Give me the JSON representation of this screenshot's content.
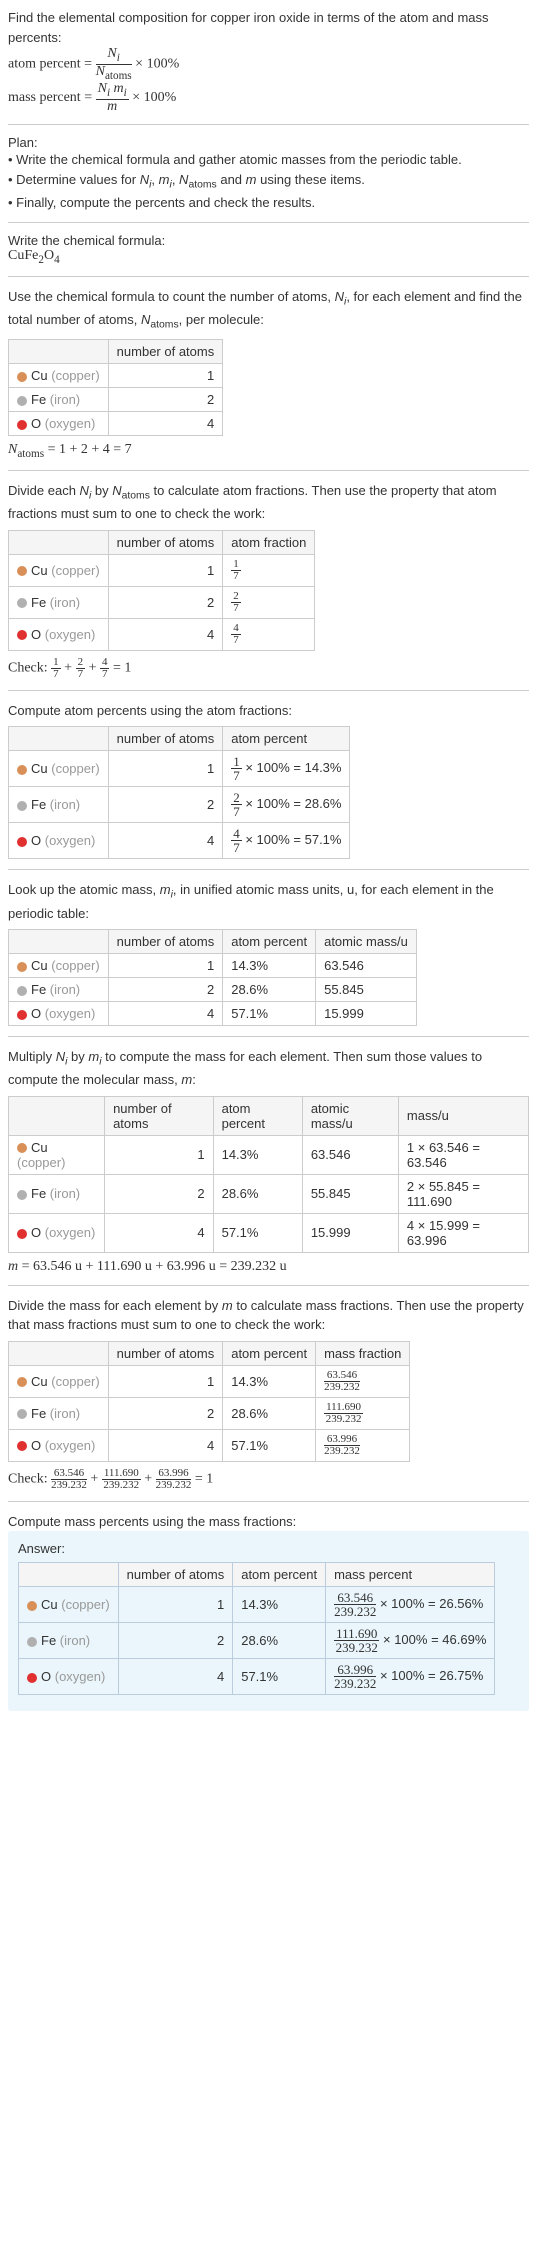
{
  "intro": {
    "text1": "Find the elemental composition for copper iron oxide in terms of the atom and mass percents:",
    "atom_formula": "atom percent = N_i / N_atoms × 100%",
    "mass_formula": "mass percent = N_i m_i / m × 100%"
  },
  "plan": {
    "title": "Plan:",
    "b1": "• Write the chemical formula and gather atomic masses from the periodic table.",
    "b2": "• Determine values for N_i, m_i, N_atoms and m using these items.",
    "b3": "• Finally, compute the percents and check the results."
  },
  "formula": {
    "title": "Write the chemical formula:",
    "value": "CuFe₂O₄"
  },
  "count": {
    "text": "Use the chemical formula to count the number of atoms, N_i, for each element and find the total number of atoms, N_atoms, per molecule:",
    "h_atoms": "number of atoms",
    "rows": [
      {
        "sym": "Cu",
        "name": "(copper)",
        "color": "#d99058",
        "n": "1"
      },
      {
        "sym": "Fe",
        "name": "(iron)",
        "color": "#b0b0b0",
        "n": "2"
      },
      {
        "sym": "O",
        "name": "(oxygen)",
        "color": "#e03030",
        "n": "4"
      }
    ],
    "total": "N_atoms = 1 + 2 + 4 = 7"
  },
  "atomfrac": {
    "text": "Divide each N_i by N_atoms to calculate atom fractions. Then use the property that atom fractions must sum to one to check the work:",
    "h_atoms": "number of atoms",
    "h_frac": "atom fraction",
    "rows": [
      {
        "sym": "Cu",
        "name": "(copper)",
        "color": "#d99058",
        "n": "1",
        "fn": "1",
        "fd": "7"
      },
      {
        "sym": "Fe",
        "name": "(iron)",
        "color": "#b0b0b0",
        "n": "2",
        "fn": "2",
        "fd": "7"
      },
      {
        "sym": "O",
        "name": "(oxygen)",
        "color": "#e03030",
        "n": "4",
        "fn": "4",
        "fd": "7"
      }
    ],
    "check": "Check: 1/7 + 2/7 + 4/7 = 1"
  },
  "atompct": {
    "text": "Compute atom percents using the atom fractions:",
    "h_atoms": "number of atoms",
    "h_pct": "atom percent",
    "rows": [
      {
        "sym": "Cu",
        "name": "(copper)",
        "color": "#d99058",
        "n": "1",
        "fn": "1",
        "fd": "7",
        "pct": "14.3%"
      },
      {
        "sym": "Fe",
        "name": "(iron)",
        "color": "#b0b0b0",
        "n": "2",
        "fn": "2",
        "fd": "7",
        "pct": "28.6%"
      },
      {
        "sym": "O",
        "name": "(oxygen)",
        "color": "#e03030",
        "n": "4",
        "fn": "4",
        "fd": "7",
        "pct": "57.1%"
      }
    ]
  },
  "atommass": {
    "text": "Look up the atomic mass, m_i, in unified atomic mass units, u, for each element in the periodic table:",
    "h_atoms": "number of atoms",
    "h_pct": "atom percent",
    "h_mass": "atomic mass/u",
    "rows": [
      {
        "sym": "Cu",
        "name": "(copper)",
        "color": "#d99058",
        "n": "1",
        "pct": "14.3%",
        "m": "63.546"
      },
      {
        "sym": "Fe",
        "name": "(iron)",
        "color": "#b0b0b0",
        "n": "2",
        "pct": "28.6%",
        "m": "55.845"
      },
      {
        "sym": "O",
        "name": "(oxygen)",
        "color": "#e03030",
        "n": "4",
        "pct": "57.1%",
        "m": "15.999"
      }
    ]
  },
  "molmass": {
    "text": "Multiply N_i by m_i to compute the mass for each element. Then sum those values to compute the molecular mass, m:",
    "h_atoms": "number of atoms",
    "h_pct": "atom percent",
    "h_amass": "atomic mass/u",
    "h_massu": "mass/u",
    "rows": [
      {
        "sym": "Cu",
        "name": "(copper)",
        "color": "#d99058",
        "n": "1",
        "pct": "14.3%",
        "m": "63.546",
        "calc": "1 × 63.546 = 63.546"
      },
      {
        "sym": "Fe",
        "name": "(iron)",
        "color": "#b0b0b0",
        "n": "2",
        "pct": "28.6%",
        "m": "55.845",
        "calc": "2 × 55.845 = 111.690"
      },
      {
        "sym": "O",
        "name": "(oxygen)",
        "color": "#e03030",
        "n": "4",
        "pct": "57.1%",
        "m": "15.999",
        "calc": "4 × 15.999 = 63.996"
      }
    ],
    "total": "m = 63.546 u + 111.690 u + 63.996 u = 239.232 u"
  },
  "massfrac": {
    "text": "Divide the mass for each element by m to calculate mass fractions. Then use the property that mass fractions must sum to one to check the work:",
    "h_atoms": "number of atoms",
    "h_pct": "atom percent",
    "h_mf": "mass fraction",
    "rows": [
      {
        "sym": "Cu",
        "name": "(copper)",
        "color": "#d99058",
        "n": "1",
        "pct": "14.3%",
        "fn": "63.546",
        "fd": "239.232"
      },
      {
        "sym": "Fe",
        "name": "(iron)",
        "color": "#b0b0b0",
        "n": "2",
        "pct": "28.6%",
        "fn": "111.690",
        "fd": "239.232"
      },
      {
        "sym": "O",
        "name": "(oxygen)",
        "color": "#e03030",
        "n": "4",
        "pct": "57.1%",
        "fn": "63.996",
        "fd": "239.232"
      }
    ],
    "check": "Check: 63.546/239.232 + 111.690/239.232 + 63.996/239.232 = 1"
  },
  "masspct": {
    "text": "Compute mass percents using the mass fractions:",
    "answer": "Answer:",
    "h_atoms": "number of atoms",
    "h_apct": "atom percent",
    "h_mpct": "mass percent",
    "rows": [
      {
        "sym": "Cu",
        "name": "(copper)",
        "color": "#d99058",
        "n": "1",
        "apct": "14.3%",
        "fn": "63.546",
        "fd": "239.232",
        "mpct": "26.56%"
      },
      {
        "sym": "Fe",
        "name": "(iron)",
        "color": "#b0b0b0",
        "n": "2",
        "apct": "28.6%",
        "fn": "111.690",
        "fd": "239.232",
        "mpct": "46.69%"
      },
      {
        "sym": "O",
        "name": "(oxygen)",
        "color": "#e03030",
        "n": "4",
        "apct": "57.1%",
        "fn": "63.996",
        "fd": "239.232",
        "mpct": "26.75%"
      }
    ]
  },
  "chart_data": {
    "type": "table",
    "title": "Elemental composition of CuFe2O4",
    "elements": [
      "Cu",
      "Fe",
      "O"
    ],
    "number_of_atoms": [
      1,
      2,
      4
    ],
    "atom_percent": [
      14.3,
      28.6,
      57.1
    ],
    "atomic_mass_u": [
      63.546,
      55.845,
      15.999
    ],
    "mass_u": [
      63.546,
      111.69,
      63.996
    ],
    "mass_percent": [
      26.56,
      46.69,
      26.75
    ],
    "N_atoms": 7,
    "molecular_mass_u": 239.232
  }
}
